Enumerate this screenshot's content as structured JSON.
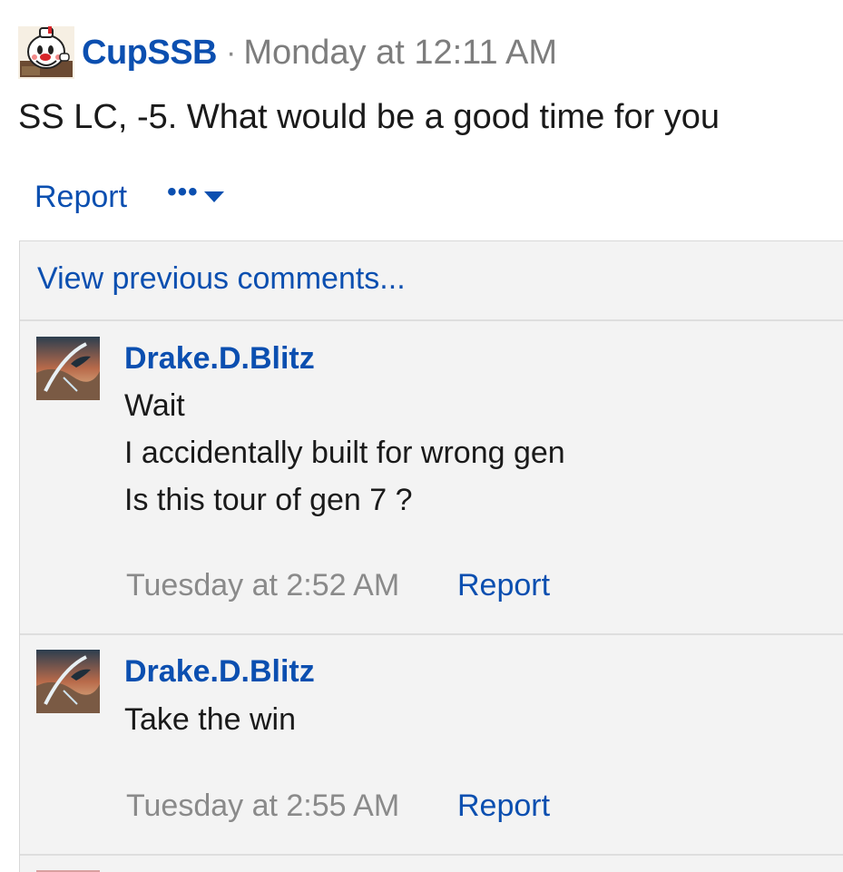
{
  "post": {
    "author": "CupSSB",
    "separator": "·",
    "time": "Monday at 12:11 AM",
    "body": "SS LC, -5. What would be a good time for you",
    "report_label": "Report",
    "more_label": "•••"
  },
  "comments": {
    "view_previous": "View previous comments...",
    "items": [
      {
        "author": "Drake.D.Blitz",
        "lines": [
          "Wait",
          "I accidentally built for wrong gen",
          "Is this tour of gen 7 ?"
        ],
        "time": "Tuesday at 2:52 AM",
        "report_label": "Report"
      },
      {
        "author": "Drake.D.Blitz",
        "lines": [
          "Take the win"
        ],
        "time": "Tuesday at 2:55 AM",
        "report_label": "Report"
      }
    ]
  },
  "colors": {
    "link": "#0b4fb0",
    "meta": "#8a8a8a",
    "comment_bg": "#f3f3f3"
  },
  "icons": {
    "post_avatar": "cuphead-avatar",
    "comment_avatar": "dragon-art-avatar",
    "more_caret": "chevron-down-icon"
  }
}
